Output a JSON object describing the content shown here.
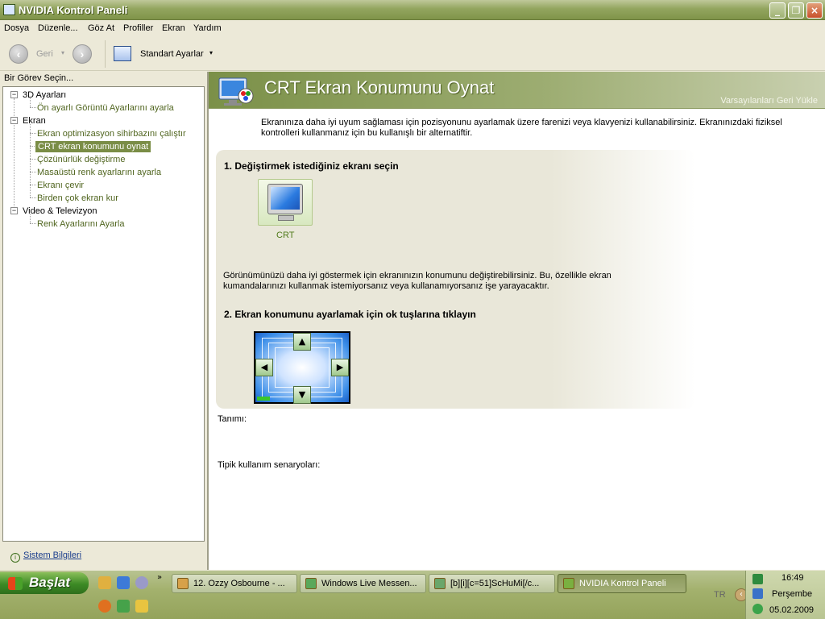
{
  "window": {
    "title": "NVIDIA Kontrol Paneli"
  },
  "menu": [
    "Dosya",
    "Düzenle...",
    "Göz At",
    "Profiller",
    "Ekran",
    "Yardım"
  ],
  "toolbar": {
    "back_label": "Geri",
    "view_label": "Standart Ayarlar"
  },
  "sidebar": {
    "header": "Bir Görev Seçin...",
    "categories": [
      {
        "label": "3D Ayarları",
        "items": [
          "Ön ayarlı Görüntü Ayarlarını ayarla"
        ]
      },
      {
        "label": "Ekran",
        "items": [
          "Ekran optimizasyon sihirbazını çalıştır",
          "CRT ekran konumunu oynat",
          "Çözünürlük değiştirme",
          "Masaüstü renk ayarlarını ayarla",
          "Ekranı çevir",
          "Birden çok ekran kur"
        ]
      },
      {
        "label": "Video & Televizyon",
        "items": [
          "Renk Ayarlarını Ayarla"
        ]
      }
    ],
    "selected": "CRT ekran konumunu oynat",
    "footer_link": "Sistem Bilgileri"
  },
  "page": {
    "title": "CRT Ekran Konumunu Oynat",
    "restore_defaults": "Varsayılanları Geri Yükle",
    "intro": "Ekranınıza daha iyi uyum sağlaması için pozisyonunu ayarlamak üzere farenizi veya klavyenizi kullanabilirsiniz. Ekranınızdaki fiziksel kontrolleri kullanmanız için bu kullanışlı bir alternatiftir.",
    "step1_title": "1. Değiştirmek istediğiniz ekranı seçin",
    "display_label": "CRT",
    "step_desc": "Görünümünüzü daha iyi göstermek için ekranınızın konumunu değiştirebilirsiniz. Bu, özellikle ekran kumandalarınızı kullanmak istemiyorsanız veya kullanamıyorsanız işe yarayacaktır.",
    "step2_title": "2. Ekran konumunu ayarlamak için ok tuşlarına tıklayın",
    "description_label": "Tanımı:",
    "scenarios_label": "Tipik kullanım senaryoları:"
  },
  "taskbar": {
    "start_label": "Başlat",
    "tasks": [
      "12. Ozzy Osbourne - ...",
      "Windows Live Messen...",
      "[b][i][c=51]ScHuMi[/c...",
      "NVIDIA Kontrol Paneli"
    ],
    "active_task": "NVIDIA Kontrol Paneli",
    "language": "TR",
    "clock": {
      "time": "16:49",
      "day": "Perşembe",
      "date": "05.02.2009"
    }
  },
  "colors": {
    "accent": "#7a8d46",
    "link": "#50651f",
    "title_bar": "#93a55f"
  }
}
